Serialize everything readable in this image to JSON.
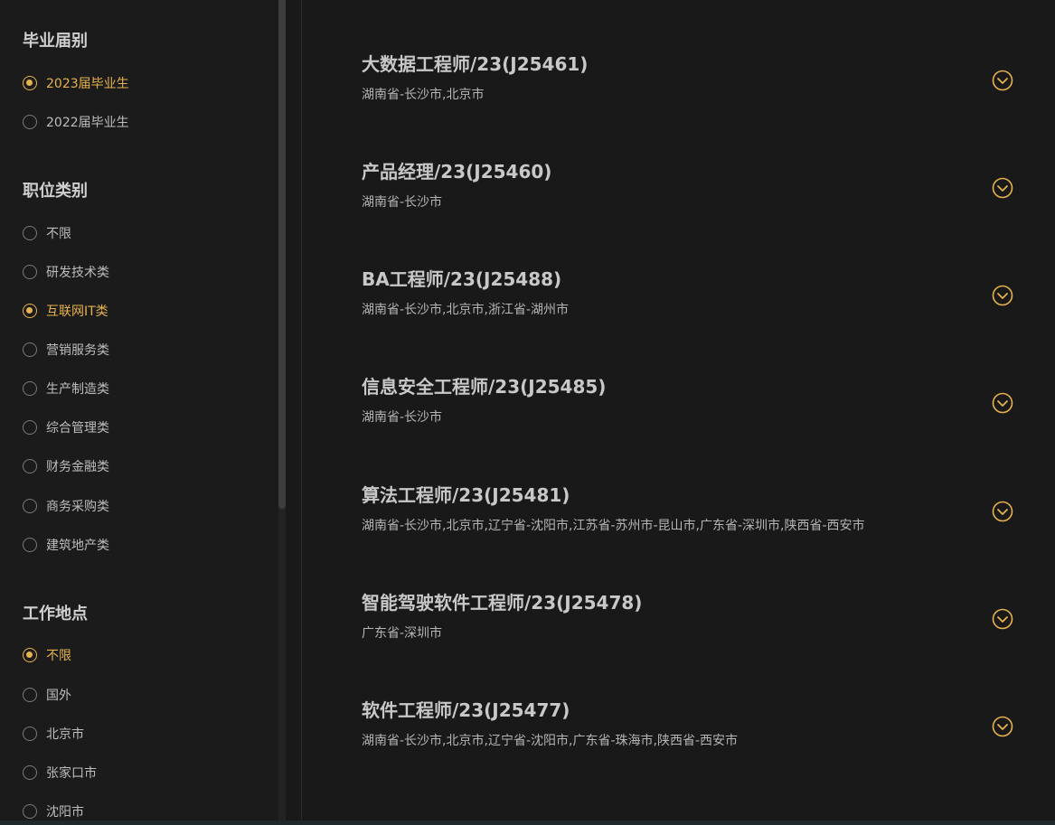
{
  "colors": {
    "background": "#191919",
    "accent": "#e6b24e",
    "text": "#c8c8c8",
    "muted": "#b5b5b5"
  },
  "sidebar": {
    "graduation": {
      "title": "毕业届别",
      "options": [
        {
          "label": "2023届毕业生",
          "selected": true
        },
        {
          "label": "2022届毕业生",
          "selected": false
        }
      ]
    },
    "category": {
      "title": "职位类别",
      "options": [
        {
          "label": "不限",
          "selected": false
        },
        {
          "label": "研发技术类",
          "selected": false
        },
        {
          "label": "互联网IT类",
          "selected": true
        },
        {
          "label": "营销服务类",
          "selected": false
        },
        {
          "label": "生产制造类",
          "selected": false
        },
        {
          "label": "综合管理类",
          "selected": false
        },
        {
          "label": "财务金融类",
          "selected": false
        },
        {
          "label": "商务采购类",
          "selected": false
        },
        {
          "label": "建筑地产类",
          "selected": false
        }
      ]
    },
    "location": {
      "title": "工作地点",
      "options": [
        {
          "label": "不限",
          "selected": true
        },
        {
          "label": "国外",
          "selected": false
        },
        {
          "label": "北京市",
          "selected": false
        },
        {
          "label": "张家口市",
          "selected": false
        },
        {
          "label": "沈阳市",
          "selected": false
        }
      ]
    }
  },
  "jobs": [
    {
      "title": "大数据工程师/23(J25461)",
      "location": "湖南省-长沙市,北京市",
      "icon": "chevron-down-circle-icon"
    },
    {
      "title": "产品经理/23(J25460)",
      "location": "湖南省-长沙市",
      "icon": "chevron-down-circle-icon"
    },
    {
      "title": "BA工程师/23(J25488)",
      "location": "湖南省-长沙市,北京市,浙江省-湖州市",
      "icon": "chevron-down-circle-icon"
    },
    {
      "title": "信息安全工程师/23(J25485)",
      "location": "湖南省-长沙市",
      "icon": "chevron-down-circle-icon"
    },
    {
      "title": "算法工程师/23(J25481)",
      "location": "湖南省-长沙市,北京市,辽宁省-沈阳市,江苏省-苏州市-昆山市,广东省-深圳市,陕西省-西安市",
      "icon": "chevron-down-circle-icon"
    },
    {
      "title": "智能驾驶软件工程师/23(J25478)",
      "location": "广东省-深圳市",
      "icon": "chevron-down-circle-icon"
    },
    {
      "title": "软件工程师/23(J25477)",
      "location": "湖南省-长沙市,北京市,辽宁省-沈阳市,广东省-珠海市,陕西省-西安市",
      "icon": "chevron-down-circle-icon"
    }
  ]
}
